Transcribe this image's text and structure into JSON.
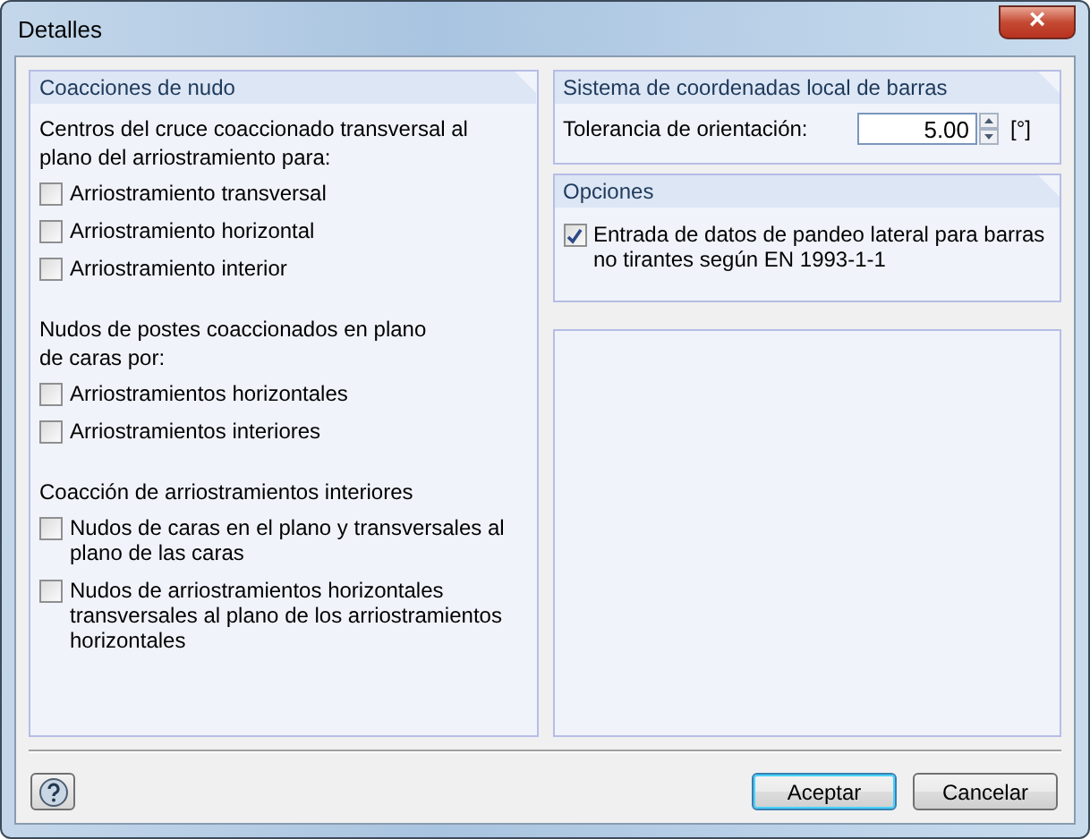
{
  "window": {
    "title": "Detalles",
    "close": "×"
  },
  "left_panel": {
    "title": "Coacciones de nudo",
    "groups": [
      {
        "heading": "Centros del cruce coaccionado transversal al plano del arriostramiento para:",
        "options": [
          {
            "label": "Arriostramiento transversal",
            "checked": false
          },
          {
            "label": "Arriostramiento horizontal",
            "checked": false
          },
          {
            "label": "Arriostramiento interior",
            "checked": false
          }
        ]
      },
      {
        "heading": "Nudos de postes coaccionados en plano\nde caras por:",
        "options": [
          {
            "label": "Arriostramientos horizontales",
            "checked": false
          },
          {
            "label": "Arriostramientos interiores",
            "checked": false
          }
        ]
      },
      {
        "heading": "Coacción de arriostramientos interiores",
        "options": [
          {
            "label": "Nudos de caras en el plano y transversales al plano de las caras",
            "checked": false
          },
          {
            "label": "Nudos de arriostramientos horizontales transversales al plano de los arriostramientos horizontales",
            "checked": false
          }
        ]
      }
    ]
  },
  "coord_panel": {
    "title": "Sistema de coordenadas local de barras",
    "label": "Tolerancia de orientación:",
    "value": "5.00",
    "unit": "[°]"
  },
  "options_panel": {
    "title": "Opciones",
    "options": [
      {
        "label": "Entrada de datos de pandeo lateral para barras no tirantes según EN 1993-1-1",
        "checked": true
      }
    ]
  },
  "buttons": [
    {
      "label": "Aceptar",
      "default": true
    },
    {
      "label": "Cancelar",
      "default": false
    }
  ]
}
